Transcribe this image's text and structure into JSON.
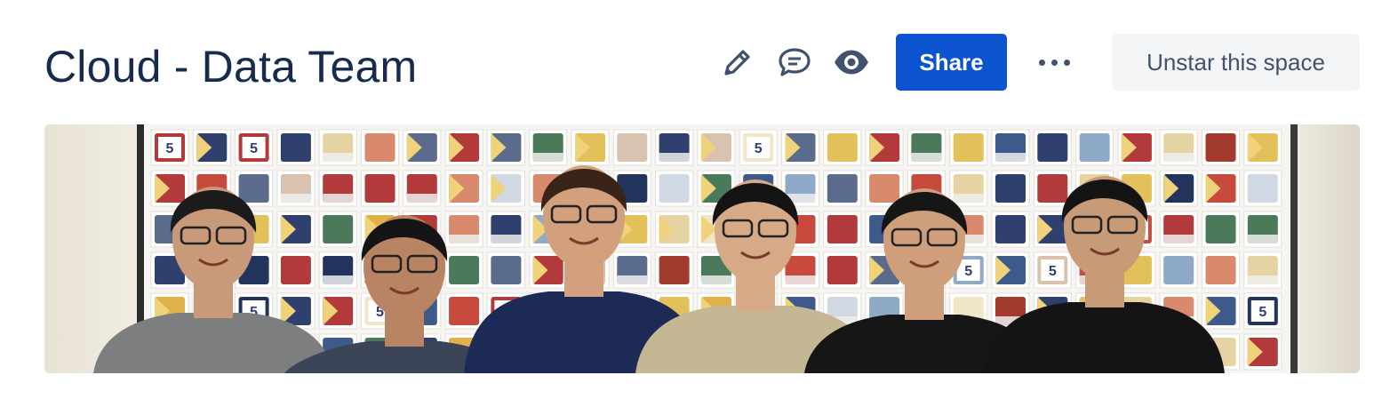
{
  "page": {
    "title": "Cloud - Data Team"
  },
  "toolbar": {
    "edit_icon": "pencil-icon",
    "comment_icon": "comment-icon",
    "watch_icon": "eye-icon",
    "share_label": "Share",
    "more_icon": "more-dots-icon",
    "unstar_label": "Unstar this space"
  },
  "banner": {
    "image": "team-photo",
    "people_count": 6
  },
  "colors": {
    "title": "#172B4D",
    "share_bg": "#0C53D0",
    "star_bg": "#F4F5F7",
    "icon": "#42526E"
  }
}
